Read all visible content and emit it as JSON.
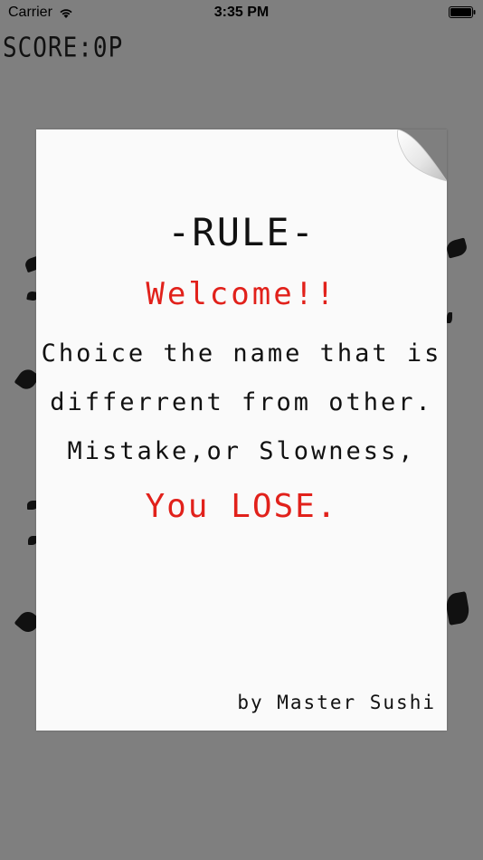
{
  "status_bar": {
    "carrier": "Carrier",
    "time": "3:35 PM",
    "wifi_icon": "wifi-icon",
    "battery_icon": "battery-icon"
  },
  "score": {
    "label": "SCORE:0P"
  },
  "rules_card": {
    "title": "-RULE-",
    "welcome": "Welcome!!",
    "line1": "Choice the name that is",
    "line2": "differrent from other.",
    "line3": "Mistake,or Slowness,",
    "lose_prefix": "You ",
    "lose_word": "LOSE.",
    "credit": "by Master Sushi"
  },
  "colors": {
    "background": "#7f7f7f",
    "paper": "#fafafa",
    "accent_red": "#e1211b",
    "ink": "#111111"
  }
}
